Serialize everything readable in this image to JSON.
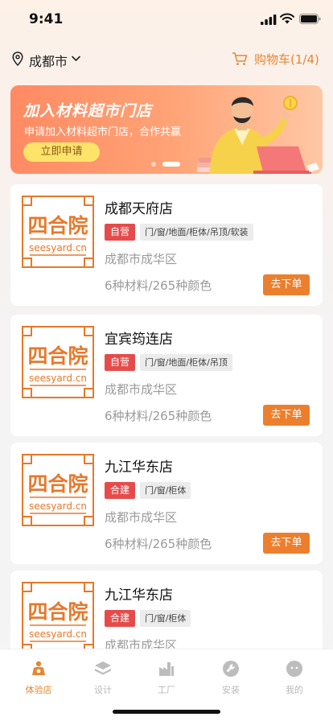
{
  "status_bar": {
    "time": "9:41"
  },
  "header": {
    "city": "成都市",
    "cart_label": "购物车(1/4)",
    "accent_color": "#e8862f"
  },
  "banner": {
    "title": "加入材料超市门店",
    "subtitle": "申请加入材料超市门店，合作共赢",
    "button_label": "立即申请"
  },
  "stores": [
    {
      "name": "成都天府店",
      "type": "自营",
      "categories": "门/窗/地面/柜体/吊顶/软装",
      "area": "成都市成华区",
      "stats": "6种材料/265种颜色",
      "button": "去下单"
    },
    {
      "name": "宜宾筠连店",
      "type": "自营",
      "categories": "门/窗/地面/柜体/吊顶",
      "area": "成都市成华区",
      "stats": "6种材料/265种颜色",
      "button": "去下单"
    },
    {
      "name": "九江华东店",
      "type": "合建",
      "categories": "门/窗/柜体",
      "area": "成都市成华区",
      "stats": "6种材料/265种颜色",
      "button": "去下单"
    },
    {
      "name": "九江华东店",
      "type": "合建",
      "categories": "门/窗/柜体",
      "area": "成都市成华区",
      "stats": "",
      "button": ""
    }
  ],
  "logo": {
    "brand": "四合院",
    "url": "seesyard.cn",
    "color": "#e8782a"
  },
  "tabbar": {
    "items": [
      {
        "label": "体验店",
        "icon": "store-icon",
        "active": true
      },
      {
        "label": "设计",
        "icon": "layers-icon",
        "active": false
      },
      {
        "label": "工厂",
        "icon": "factory-icon",
        "active": false
      },
      {
        "label": "安装",
        "icon": "wrench-icon",
        "active": false
      },
      {
        "label": "我的",
        "icon": "profile-icon",
        "active": false
      }
    ]
  }
}
